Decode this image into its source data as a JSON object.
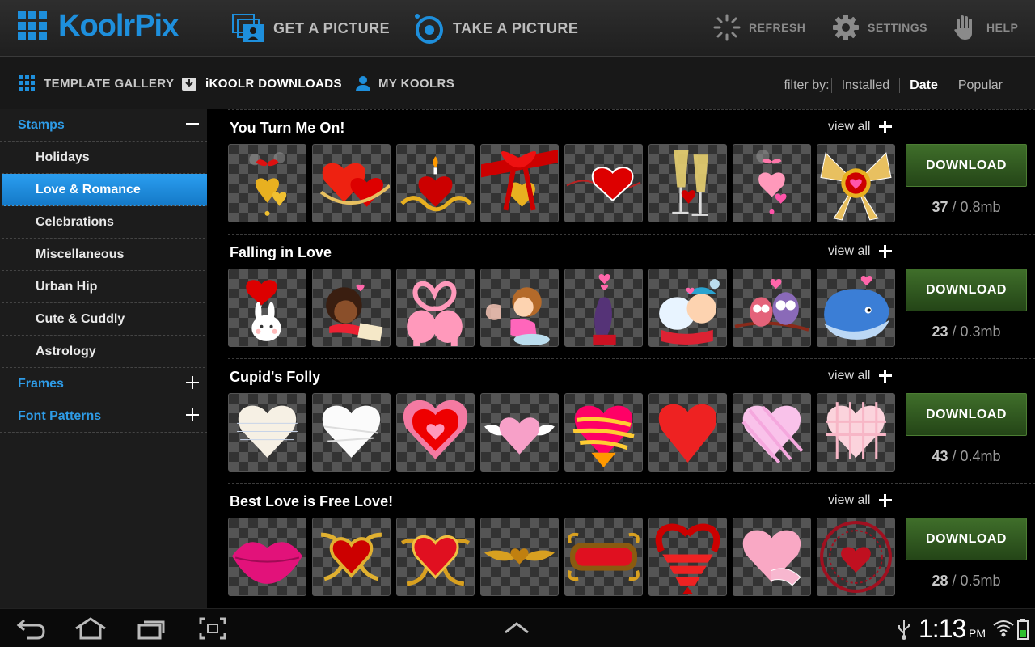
{
  "app": {
    "title": "KoolrPix"
  },
  "toolbar": {
    "get_picture": "GET A PICTURE",
    "take_picture": "TAKE A PICTURE",
    "refresh": "REFRESH",
    "settings": "SETTINGS",
    "help": "HELP"
  },
  "tabs": {
    "template_gallery": "TEMPLATE GALLERY",
    "downloads": "iKOOLR DOWNLOADS",
    "my_koolrs": "MY KOOLRS"
  },
  "filter": {
    "label": "filter by:",
    "options": [
      "Installed",
      "Date",
      "Popular"
    ],
    "selected": "Date"
  },
  "sidebar": {
    "categories": [
      {
        "label": "Stamps",
        "expanded": true,
        "children": [
          "Holidays",
          "Love & Romance",
          "Celebrations",
          "Miscellaneous",
          "Urban Hip",
          "Cute & Cuddly",
          "Astrology"
        ]
      },
      {
        "label": "Frames",
        "expanded": false
      },
      {
        "label": "Font Patterns",
        "expanded": false
      }
    ],
    "selected": "Love & Romance"
  },
  "packs": [
    {
      "title": "You Turn Me On!",
      "view_all": "view all",
      "download": "DOWNLOAD",
      "count": "37",
      "size": " / 0.8mb",
      "thumbs": [
        "hearts-bells",
        "two-red-hearts",
        "candle-heart",
        "ribbon-heart",
        "red-heart-swirl",
        "champagne-glasses",
        "pink-hearts-chain",
        "golden-bow-heart"
      ]
    },
    {
      "title": "Falling in Love",
      "view_all": "view all",
      "download": "DOWNLOAD",
      "count": "23",
      "size": " / 0.3mb",
      "thumbs": [
        "bunny-balloon",
        "girl-writing",
        "pink-elephants",
        "cupid-girl",
        "seal-hearts",
        "bears-couple",
        "owls-branch",
        "blue-whale"
      ]
    },
    {
      "title": "Cupid's Folly",
      "view_all": "view all",
      "download": "DOWNLOAD",
      "count": "43",
      "size": " / 0.4mb",
      "thumbs": [
        "paper-heart",
        "white-heart",
        "lace-heart",
        "winged-heart",
        "striped-heart",
        "red-heart",
        "pink-striped-heart",
        "gingham-heart"
      ]
    },
    {
      "title": "Best Love is Free Love!",
      "view_all": "view all",
      "download": "DOWNLOAD",
      "count": "28",
      "size": " / 0.5mb",
      "thumbs": [
        "pink-lips",
        "gold-ornate-heart",
        "gold-filigree-heart",
        "gold-wings",
        "ornate-frame",
        "ribbon-spiral-heart",
        "scroll-heart",
        "stamp-heart"
      ]
    }
  ],
  "status": {
    "time": "1:13",
    "ampm": "PM"
  },
  "colors": {
    "accent": "#1e8fdc",
    "download": "#2f5a1f",
    "selected": "#1a84d6"
  }
}
